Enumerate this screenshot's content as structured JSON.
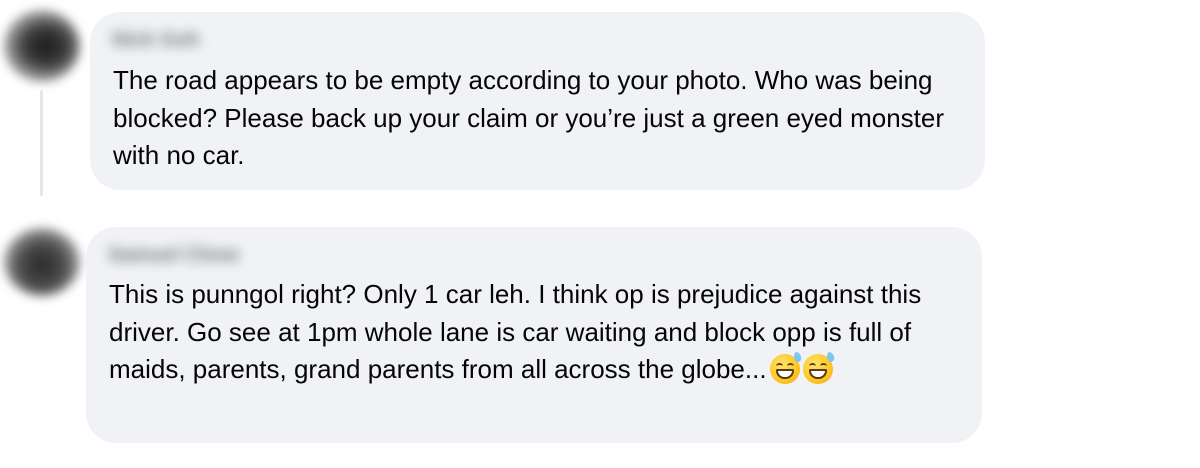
{
  "comments": [
    {
      "author": "Nick Goh",
      "text": "The road appears to be empty according to your photo. Who was being blocked? Please back up your claim or you’re just a green eyed monster with no car."
    },
    {
      "author": "Samuel Chow",
      "text": "This is punngol right? Only 1 car leh. I think op is prejudice against this driver. Go see at 1pm whole lane is car waiting and block opp is full of maids, parents, grand parents from all across the globe...",
      "emojis": [
        "grinning-face-with-sweat-icon",
        "grinning-face-with-sweat-icon"
      ]
    }
  ],
  "colors": {
    "bubble_bg": "#f0f2f5",
    "text": "#050505",
    "thread_line": "#e4e6eb"
  }
}
